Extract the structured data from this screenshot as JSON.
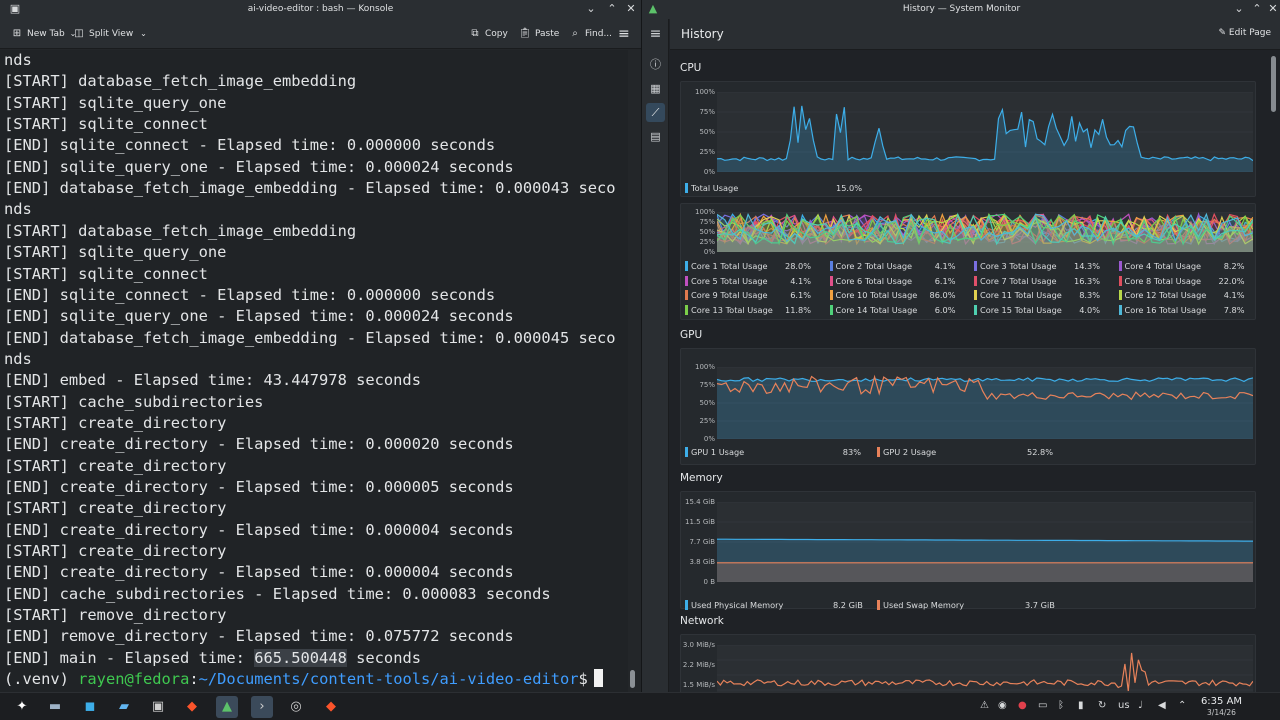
{
  "konsole": {
    "title": "ai-video-editor : bash — Konsole",
    "toolbar": {
      "new_tab": "New Tab",
      "split_view": "Split View",
      "copy": "Copy",
      "paste": "Paste",
      "find": "Find..."
    },
    "lines": [
      "nds",
      "[START] database_fetch_image_embedding",
      "[START] sqlite_query_one",
      "[START] sqlite_connect",
      "[END] sqlite_connect - Elapsed time: 0.000000 seconds",
      "[END] sqlite_query_one - Elapsed time: 0.000024 seconds",
      "[END] database_fetch_image_embedding - Elapsed time: 0.000043 seco",
      "nds",
      "[START] database_fetch_image_embedding",
      "[START] sqlite_query_one",
      "[START] sqlite_connect",
      "[END] sqlite_connect - Elapsed time: 0.000000 seconds",
      "[END] sqlite_query_one - Elapsed time: 0.000024 seconds",
      "[END] database_fetch_image_embedding - Elapsed time: 0.000045 seco",
      "nds",
      "[END] embed - Elapsed time: 43.447978 seconds",
      "[START] cache_subdirectories",
      "[START] create_directory",
      "[END] create_directory - Elapsed time: 0.000020 seconds",
      "[START] create_directory",
      "[END] create_directory - Elapsed time: 0.000005 seconds",
      "[START] create_directory",
      "[END] create_directory - Elapsed time: 0.000004 seconds",
      "[START] create_directory",
      "[END] create_directory - Elapsed time: 0.000004 seconds",
      "[END] cache_subdirectories - Elapsed time: 0.000083 seconds",
      "[START] remove_directory",
      "[END] remove_directory - Elapsed time: 0.075772 seconds"
    ],
    "last_line": {
      "prefix": "[END] main - Elapsed time: ",
      "selected": "665.500448",
      "suffix": " seconds"
    },
    "prompt": {
      "venv": "(.venv) ",
      "user_host": "rayen@fedora",
      "sep": ":",
      "path": "~/Documents/content-tools/ai-video-editor",
      "symbol": "$"
    }
  },
  "sysmon": {
    "title": "History — System Monitor",
    "page_title": "History",
    "edit_page": "Edit Page",
    "sections": {
      "cpu": "CPU",
      "gpu": "GPU",
      "memory": "Memory",
      "network": "Network"
    },
    "percent_ticks": [
      "100%",
      "75%",
      "50%",
      "25%",
      "0%"
    ],
    "memory_ticks": [
      "15.4 GiB",
      "11.5 GiB",
      "7.7 GiB",
      "3.8 GiB",
      "0 B"
    ],
    "network_ticks": [
      "3.0 MiB/s",
      "2.2 MiB/s",
      "1.5 MiB/s"
    ],
    "cpu_total": {
      "label": "Total Usage",
      "value": "15.0%",
      "color": "#3daee9"
    },
    "cores": [
      {
        "label": "Core 1 Total Usage",
        "value": "28.0%",
        "color": "#3daee9"
      },
      {
        "label": "Core 2 Total Usage",
        "value": "4.1%",
        "color": "#5a7fe0"
      },
      {
        "label": "Core 3 Total Usage",
        "value": "14.3%",
        "color": "#7a6fe0"
      },
      {
        "label": "Core 4 Total Usage",
        "value": "8.2%",
        "color": "#9b59d0"
      },
      {
        "label": "Core 5 Total Usage",
        "value": "4.1%",
        "color": "#c050c0"
      },
      {
        "label": "Core 6 Total Usage",
        "value": "6.1%",
        "color": "#e0508a"
      },
      {
        "label": "Core 7 Total Usage",
        "value": "16.3%",
        "color": "#e0506a"
      },
      {
        "label": "Core 8 Total Usage",
        "value": "22.0%",
        "color": "#e04f5f"
      },
      {
        "label": "Core 9 Total Usage",
        "value": "6.1%",
        "color": "#e07a4f"
      },
      {
        "label": "Core 10 Total Usage",
        "value": "86.0%",
        "color": "#f0a040"
      },
      {
        "label": "Core 11 Total Usage",
        "value": "8.3%",
        "color": "#e0d050"
      },
      {
        "label": "Core 12 Total Usage",
        "value": "4.1%",
        "color": "#b8d84a"
      },
      {
        "label": "Core 13 Total Usage",
        "value": "11.8%",
        "color": "#7ccf4a"
      },
      {
        "label": "Core 14 Total Usage",
        "value": "6.0%",
        "color": "#4fd07a"
      },
      {
        "label": "Core 15 Total Usage",
        "value": "4.0%",
        "color": "#4fd0b0"
      },
      {
        "label": "Core 16 Total Usage",
        "value": "7.8%",
        "color": "#4fb8d8"
      }
    ],
    "gpu": [
      {
        "label": "GPU 1 Usage",
        "value": "83%",
        "color": "#3daee9"
      },
      {
        "label": "GPU 2 Usage",
        "value": "52.8%",
        "color": "#e8825a"
      }
    ],
    "memory": [
      {
        "label": "Used Physical Memory",
        "value": "8.2 GiB",
        "color": "#3daee9"
      },
      {
        "label": "Used Swap Memory",
        "value": "3.7 GiB",
        "color": "#e8825a"
      }
    ]
  },
  "taskbar": {
    "apps": [
      "app-launcher",
      "files",
      "discover",
      "dolphin",
      "konsole",
      "brave",
      "system-monitor",
      "terminal",
      "obs",
      "brave"
    ],
    "keyboard_layout": "us",
    "time": "6:35 AM",
    "date": "3/14/26"
  }
}
